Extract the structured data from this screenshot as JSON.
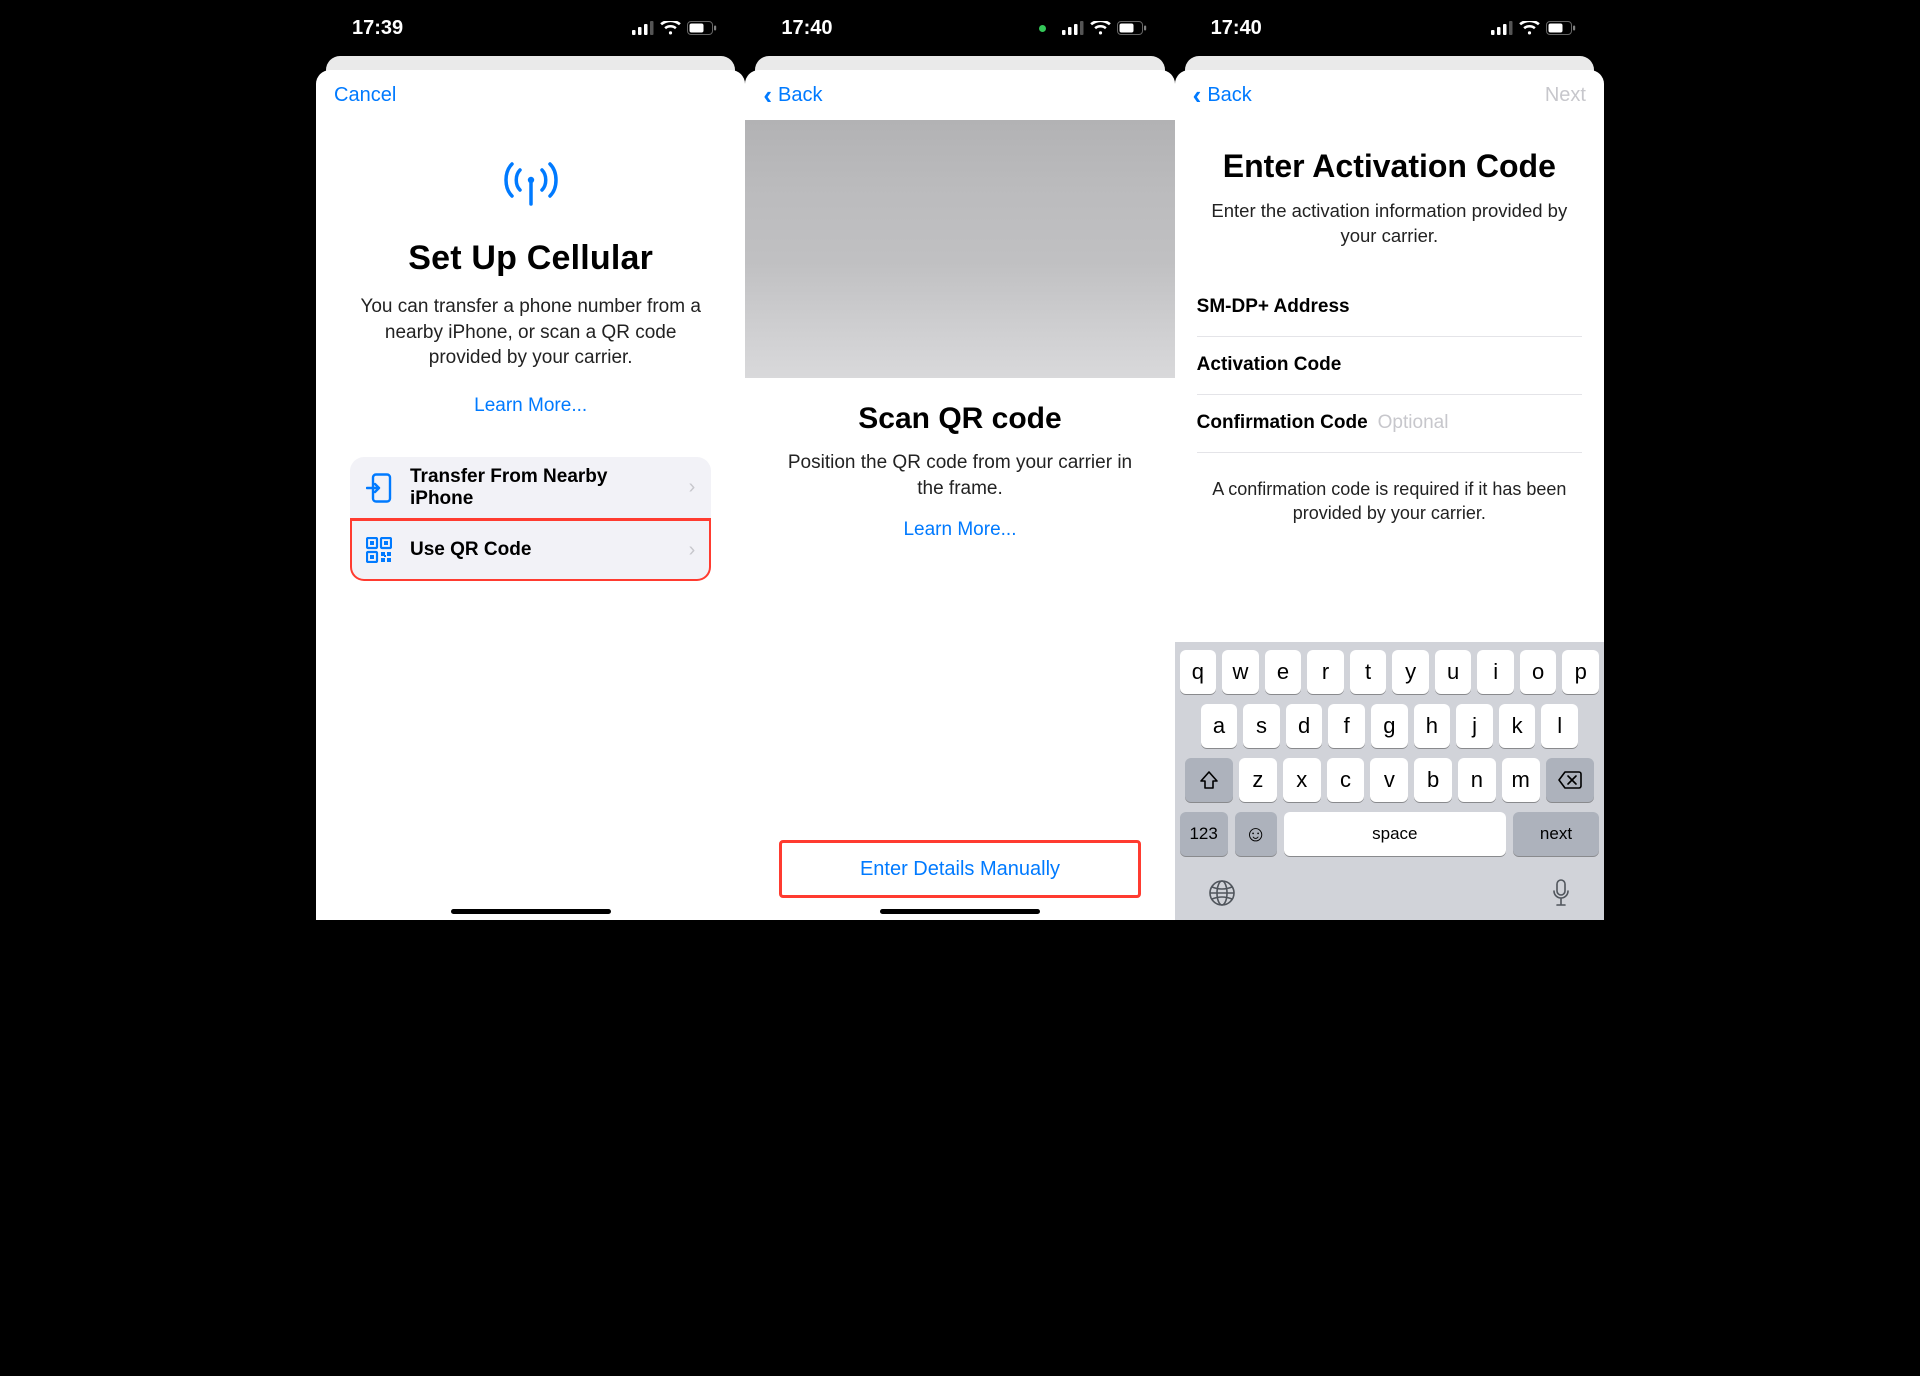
{
  "screens": [
    {
      "status_time": "17:39",
      "nav": {
        "cancel": "Cancel"
      },
      "title": "Set Up Cellular",
      "description": "You can transfer a phone number from a nearby iPhone, or scan a QR code provided by your carrier.",
      "learn_more": "Learn More...",
      "options": [
        {
          "icon": "transfer-icon",
          "label": "Transfer From Nearby iPhone"
        },
        {
          "icon": "qr-icon",
          "label": "Use QR Code"
        }
      ]
    },
    {
      "status_time": "17:40",
      "nav": {
        "back": "Back"
      },
      "title": "Scan QR code",
      "description": "Position the QR code from your carrier in the frame.",
      "learn_more": "Learn More...",
      "manual": "Enter Details Manually"
    },
    {
      "status_time": "17:40",
      "nav": {
        "back": "Back",
        "next": "Next"
      },
      "title": "Enter Activation Code",
      "description": "Enter the activation information provided by your carrier.",
      "fields": [
        {
          "label": "SM-DP+ Address",
          "placeholder": ""
        },
        {
          "label": "Activation Code",
          "placeholder": ""
        },
        {
          "label": "Confirmation Code",
          "placeholder": "Optional"
        }
      ],
      "note": "A confirmation code is required if it has been provided by your carrier.",
      "keyboard": {
        "row1": [
          "q",
          "w",
          "e",
          "r",
          "t",
          "y",
          "u",
          "i",
          "o",
          "p"
        ],
        "row2": [
          "a",
          "s",
          "d",
          "f",
          "g",
          "h",
          "j",
          "k",
          "l"
        ],
        "row3": [
          "z",
          "x",
          "c",
          "v",
          "b",
          "n",
          "m"
        ],
        "numbers": "123",
        "space": "space",
        "next": "next"
      }
    }
  ]
}
